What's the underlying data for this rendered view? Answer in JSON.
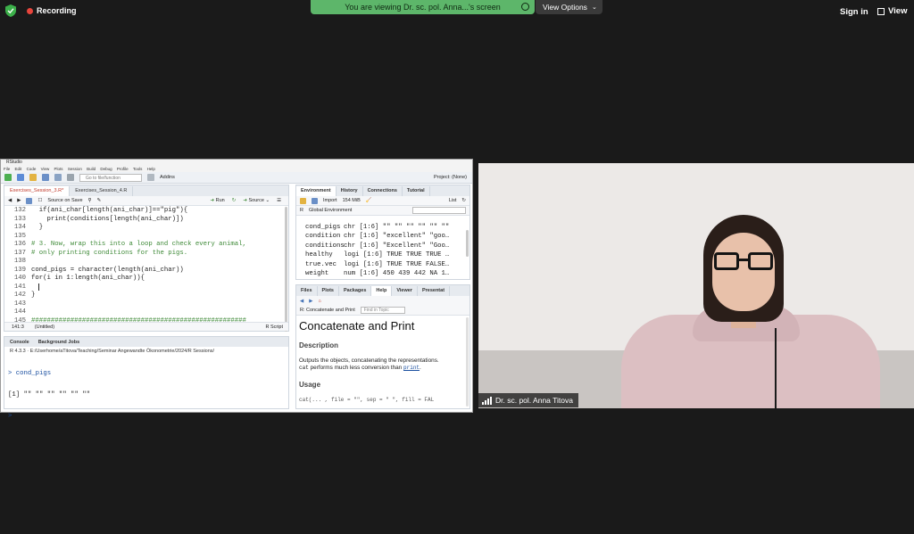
{
  "zoom": {
    "recording_label": "Recording",
    "viewing_banner": "You are viewing Dr. sc. pol. Anna...'s screen",
    "view_options_label": "View Options",
    "sign_in_label": "Sign in",
    "view_label": "View",
    "participant_name": "Dr. sc. pol. Anna Titova",
    "colors": {
      "banner": "#5db66a",
      "record_dot": "#e8453c"
    }
  },
  "rstudio": {
    "window_title": "RStudio",
    "menu_items": [
      "File",
      "Edit",
      "Code",
      "View",
      "Plots",
      "Session",
      "Build",
      "Debug",
      "Profile",
      "Tools",
      "Help"
    ],
    "toolbar": {
      "goto_placeholder": "Go to file/function",
      "addins_label": "Addins",
      "project_label": "Project: (None)"
    },
    "editor": {
      "tabs": [
        {
          "label": "Exercises_Session_3.R*"
        },
        {
          "label": "Exercises_Session_4.R"
        }
      ],
      "source_on_save": "Source on Save",
      "run_label": "Run",
      "source_label": "Source",
      "lines": [
        {
          "n": "132",
          "text": "  if(ani_char[length(ani_char)]==\"pig\"){"
        },
        {
          "n": "133",
          "text": "    print(conditions[length(ani_char)])"
        },
        {
          "n": "134",
          "text": "  }"
        },
        {
          "n": "135",
          "text": ""
        },
        {
          "n": "136",
          "text": "# 3. Now, wrap this into a loop and check every animal,"
        },
        {
          "n": "137",
          "text": "# only printing conditions for the pigs."
        },
        {
          "n": "138",
          "text": ""
        },
        {
          "n": "139",
          "text": "cond_pigs = character(length(ani_char))"
        },
        {
          "n": "140",
          "text": "for(i in 1:length(ani_char)){"
        },
        {
          "n": "141",
          "text": ""
        },
        {
          "n": "142",
          "text": "}"
        },
        {
          "n": "143",
          "text": ""
        },
        {
          "n": "144",
          "text": ""
        },
        {
          "n": "145",
          "text": "#######################################################"
        }
      ],
      "status_pos": "141:3",
      "status_scope": "(Untitled)",
      "status_lang": "R Script"
    },
    "console": {
      "tabs": [
        "Console",
        "Background Jobs"
      ],
      "path": "R 4.3.3 · E:/Userhome/aTitova/Teaching/Seminar Angewandte Ökonometrie/2024/R Sessions/",
      "cmd": "> cond_pigs",
      "output": "[1] \"\" \"\" \"\" \"\" \"\" \"\"",
      "prompt": "> "
    },
    "environment": {
      "tabs": [
        "Environment",
        "History",
        "Connections",
        "Tutorial"
      ],
      "import_label": "Import",
      "memory_label": "154 MiB",
      "list_label": "List",
      "lang_label": "R",
      "scope_label": "Global Environment",
      "rows": [
        {
          "name": "cond_pigs",
          "value": "chr [1:6] \"\" \"\" \"\" \"\" \"\" \"\""
        },
        {
          "name": "condition",
          "value": "chr [1:6] \"excellent\" \"goo…"
        },
        {
          "name": "conditions",
          "value": "chr [1:6] \"Excellent\" \"Goo…"
        },
        {
          "name": "healthy",
          "value": "logi [1:6] TRUE TRUE TRUE …"
        },
        {
          "name": "true.vec",
          "value": "logi [1:6] TRUE TRUE FALSE…"
        },
        {
          "name": "weight",
          "value": "num [1:6] 450 439 442 NA 1…"
        }
      ]
    },
    "help": {
      "tabs": [
        "Files",
        "Plots",
        "Packages",
        "Help",
        "Viewer",
        "Presentat"
      ],
      "topic_label": "R: Concatenate and Print",
      "find_placeholder": "Find in Topic",
      "title": "Concatenate and Print",
      "description_heading": "Description",
      "description_1": "Outputs the objects, concatenating the representations.",
      "description_code": "cat",
      "description_2": " performs much less conversion than ",
      "description_link": "print",
      "description_end": ".",
      "usage_heading": "Usage",
      "usage_code": "cat(... , file = \"\", sep = \" \", fill = FAL"
    }
  }
}
